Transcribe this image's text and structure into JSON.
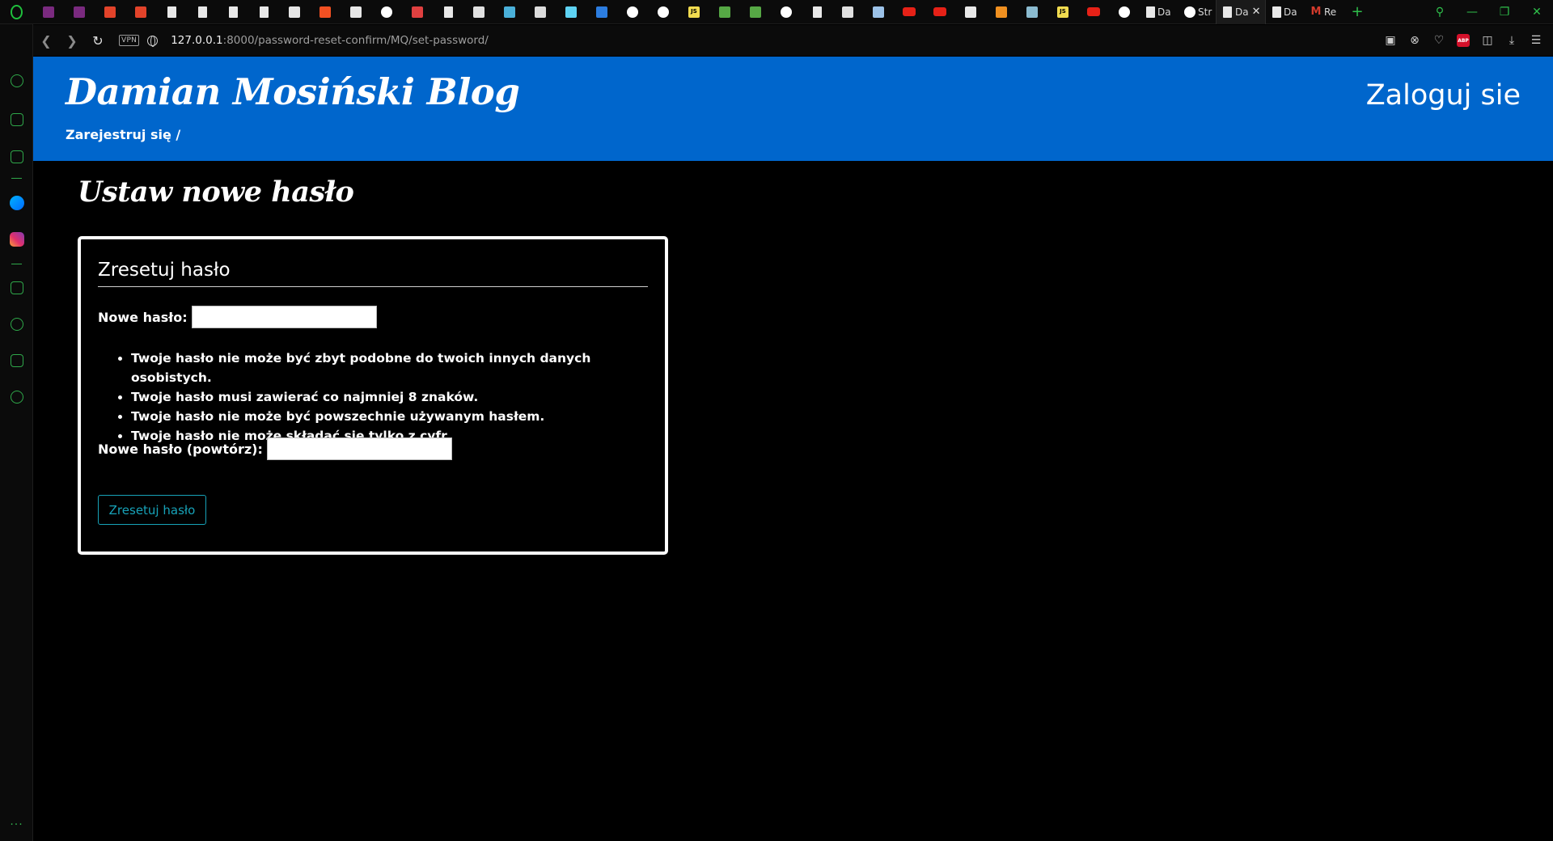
{
  "browser": {
    "url_host": "127.0.0.1",
    "url_path": ":8000/password-reset-confirm/MQ/set-password/",
    "vpn_label": "VPN",
    "tabs": [
      {
        "icon": "slack-icon"
      },
      {
        "icon": "slack-icon"
      },
      {
        "icon": "gitlab-icon"
      },
      {
        "icon": "gitlab-icon"
      },
      {
        "icon": "document-icon"
      },
      {
        "icon": "document-icon"
      },
      {
        "icon": "document-icon"
      },
      {
        "icon": "document-icon"
      },
      {
        "icon": "python-icon"
      },
      {
        "icon": "microsoft-icon"
      },
      {
        "icon": "python-icon"
      },
      {
        "icon": "github-icon"
      },
      {
        "icon": "rocket-icon"
      },
      {
        "icon": "document-icon"
      },
      {
        "icon": "stackoverflow-icon"
      },
      {
        "icon": "codepen-icon"
      },
      {
        "icon": "news-icon"
      },
      {
        "icon": "react-icon"
      },
      {
        "icon": "webstorm-icon"
      },
      {
        "icon": "github-icon"
      },
      {
        "icon": "github-icon"
      },
      {
        "icon": "javascript-icon"
      },
      {
        "icon": "node-icon"
      },
      {
        "icon": "node-icon"
      },
      {
        "icon": "github-icon"
      },
      {
        "icon": "document-icon"
      },
      {
        "icon": "globe-icon"
      },
      {
        "icon": "book-icon"
      },
      {
        "icon": "youtube-icon"
      },
      {
        "icon": "youtube-icon"
      },
      {
        "icon": "lightbulb-icon"
      },
      {
        "icon": "orange-app-icon"
      },
      {
        "icon": "image-icon"
      },
      {
        "icon": "javascript-icon"
      },
      {
        "icon": "youtube-icon"
      },
      {
        "icon": "github-icon"
      }
    ],
    "labeled_tabs": [
      {
        "icon": "document-icon",
        "label": "Da"
      },
      {
        "icon": "github-icon",
        "label": "Str"
      }
    ],
    "active_tab_label": "Da",
    "after_tabs": [
      {
        "icon": "document-icon",
        "label": "Da"
      },
      {
        "icon": "gmail-icon",
        "label": "Re"
      }
    ],
    "new_tab_symbol": "+",
    "abp_label": "ABP"
  },
  "site": {
    "title": "Damian Mosiński Blog",
    "register_link": "Zarejestruj się /",
    "login_link": "Zaloguj sie"
  },
  "page": {
    "heading": "Ustaw nowe hasło",
    "form": {
      "legend": "Zresetuj hasło",
      "new_password_label": "Nowe hasło:",
      "new_password_value": "",
      "confirm_password_label": "Nowe hasło (powtórz):",
      "confirm_password_value": "",
      "help_items": [
        "Twoje hasło nie może być zbyt podobne do twoich innych danych osobistych.",
        "Twoje hasło musi zawierać co najmniej 8 znaków.",
        "Twoje hasło nie może być powszechnie używanym hasłem.",
        "Twoje hasło nie może składać się tylko z cyfr."
      ],
      "submit_label": "Zresetuj hasło"
    }
  },
  "colors": {
    "header_blue": "#0066cc",
    "button_teal": "#17a2b8",
    "opera_green": "#2fa84a"
  }
}
